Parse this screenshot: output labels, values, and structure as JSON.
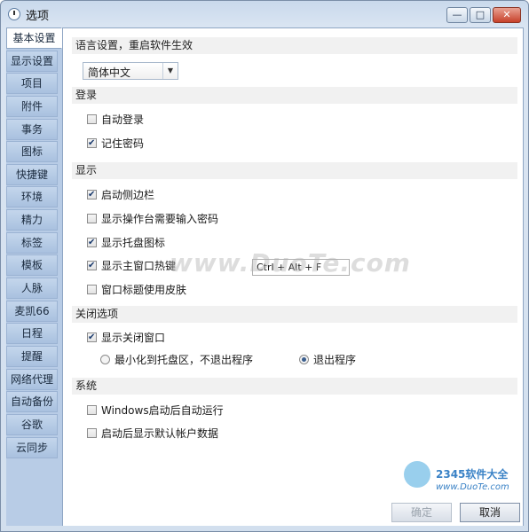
{
  "window": {
    "title": "选项",
    "minimize_glyph": "—",
    "maximize_glyph": "□",
    "close_glyph": "✕"
  },
  "sidebar": {
    "items": [
      {
        "label": "基本设置",
        "active": true
      },
      {
        "label": "显示设置"
      },
      {
        "label": "项目"
      },
      {
        "label": "附件"
      },
      {
        "label": "事务"
      },
      {
        "label": "图标"
      },
      {
        "label": "快捷键"
      },
      {
        "label": "环境"
      },
      {
        "label": "精力"
      },
      {
        "label": "标签"
      },
      {
        "label": "模板"
      },
      {
        "label": "人脉"
      },
      {
        "label": "麦凯66"
      },
      {
        "label": "日程"
      },
      {
        "label": "提醒"
      },
      {
        "label": "网络代理"
      },
      {
        "label": "自动备份"
      },
      {
        "label": "谷歌"
      },
      {
        "label": "云同步"
      }
    ]
  },
  "sections": {
    "language": {
      "title": "语言设置，重启软件生效",
      "selected": "简体中文",
      "dropdown_glyph": "▼"
    },
    "login": {
      "title": "登录",
      "auto_login": {
        "label": "自动登录",
        "checked": false
      },
      "remember_password": {
        "label": "记住密码",
        "checked": true
      }
    },
    "display": {
      "title": "显示",
      "show_sidebar": {
        "label": "启动侧边栏",
        "checked": true
      },
      "workbench_password": {
        "label": "显示操作台需要输入密码",
        "checked": false
      },
      "tray_icon": {
        "label": "显示托盘图标",
        "checked": true
      },
      "main_hotkey": {
        "label": "显示主窗口热键",
        "checked": true,
        "value": "Ctrl + Alt + F"
      },
      "window_skin": {
        "label": "窗口标题使用皮肤",
        "checked": false
      }
    },
    "close": {
      "title": "关闭选项",
      "show_close_window": {
        "label": "显示关闭窗口",
        "checked": true
      },
      "minimize_to_tray": {
        "label": "最小化到托盘区，不退出程序",
        "selected": false
      },
      "exit_program": {
        "label": "退出程序",
        "selected": true
      }
    },
    "system": {
      "title": "系统",
      "auto_run": {
        "label": "Windows启动后自动运行",
        "checked": false
      },
      "show_default_account": {
        "label": "启动后显示默认帐户数据",
        "checked": false
      }
    }
  },
  "buttons": {
    "ok": "确定",
    "cancel": "取消"
  },
  "watermarks": {
    "main": "www.DuoTe.com",
    "brand": "2345软件大全",
    "url": "www.DuoTe.com"
  }
}
